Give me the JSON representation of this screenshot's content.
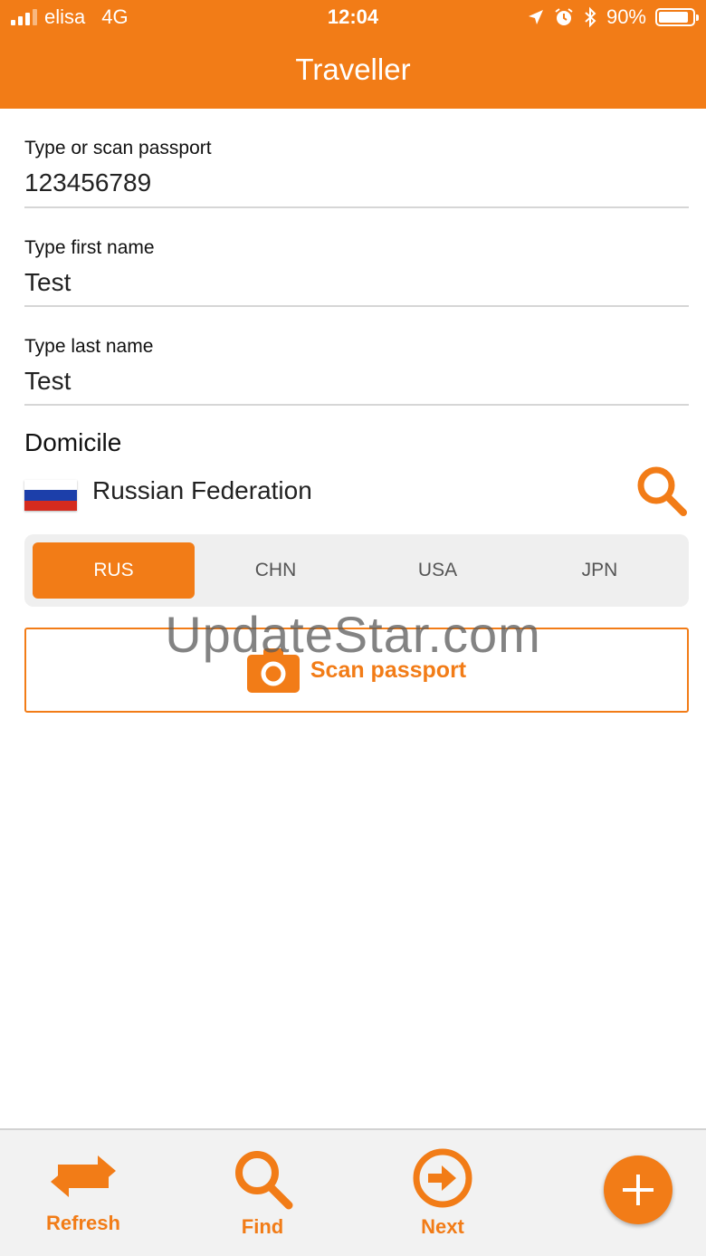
{
  "status_bar": {
    "carrier": "elisa",
    "network": "4G",
    "time": "12:04",
    "battery_percent": "90%",
    "battery_level": 0.9,
    "icons": [
      "location-arrow-icon",
      "alarm-icon",
      "bluetooth-icon"
    ]
  },
  "nav": {
    "title": "Traveller"
  },
  "form": {
    "passport": {
      "label": "Type or scan passport",
      "value": "123456789"
    },
    "first_name": {
      "label": "Type first name",
      "value": "Test"
    },
    "last_name": {
      "label": "Type last name",
      "value": "Test"
    }
  },
  "domicile": {
    "title": "Domicile",
    "country": "Russian Federation",
    "flag_colors": [
      "#ffffff",
      "#1c3faa",
      "#d52b1e"
    ],
    "search_icon": "search-icon"
  },
  "country_segments": {
    "options": [
      "RUS",
      "CHN",
      "USA",
      "JPN"
    ],
    "selected": "RUS"
  },
  "scan": {
    "label": "Scan passport",
    "icon": "camera-icon"
  },
  "watermark": "UpdateStar.com",
  "toolbar": {
    "refresh_label": "Refresh",
    "find_label": "Find",
    "next_label": "Next",
    "add_icon": "plus-icon"
  },
  "colors": {
    "accent": "#F27C17"
  }
}
